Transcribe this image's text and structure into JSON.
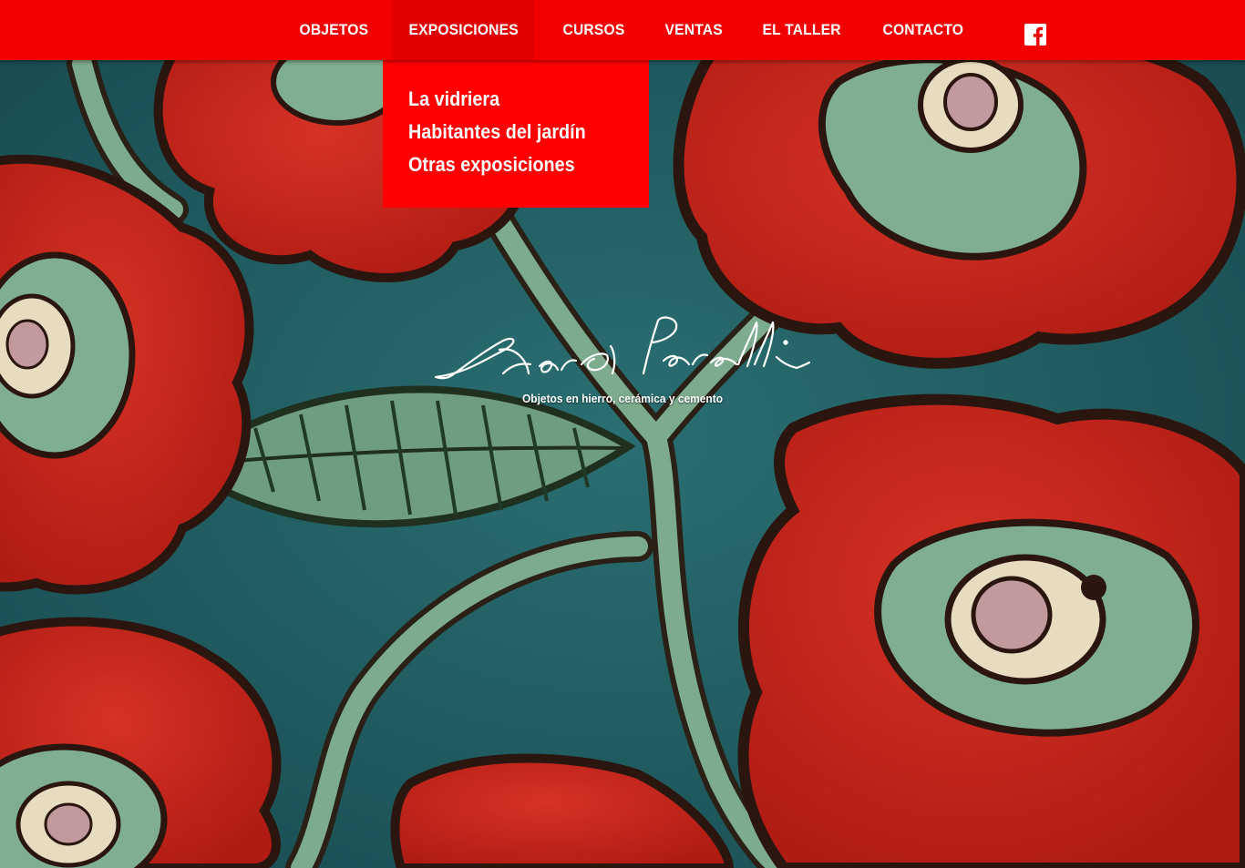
{
  "nav": {
    "items": [
      {
        "label": "OBJETOS",
        "active": false
      },
      {
        "label": "EXPOSICIONES",
        "active": true
      },
      {
        "label": "CURSOS",
        "active": false
      },
      {
        "label": "VENTAS",
        "active": false
      },
      {
        "label": "EL TALLER",
        "active": false
      },
      {
        "label": "CONTACTO",
        "active": false
      }
    ],
    "social_icon": "facebook-icon"
  },
  "dropdown": {
    "items": [
      {
        "label": "La vidriera"
      },
      {
        "label": "Habitantes del jardín"
      },
      {
        "label": "Otras exposiciones"
      }
    ]
  },
  "hero": {
    "signature": "Charo Perelli",
    "tagline": "Objetos en hierro, cerámica y cemento"
  },
  "colors": {
    "nav_red": "#f20000",
    "dropdown_red": "#ff0000",
    "flower_red": "#c8231a",
    "teal_background": "#1f5a5e",
    "sage_green": "#7fae92",
    "text": "#ffffff"
  }
}
